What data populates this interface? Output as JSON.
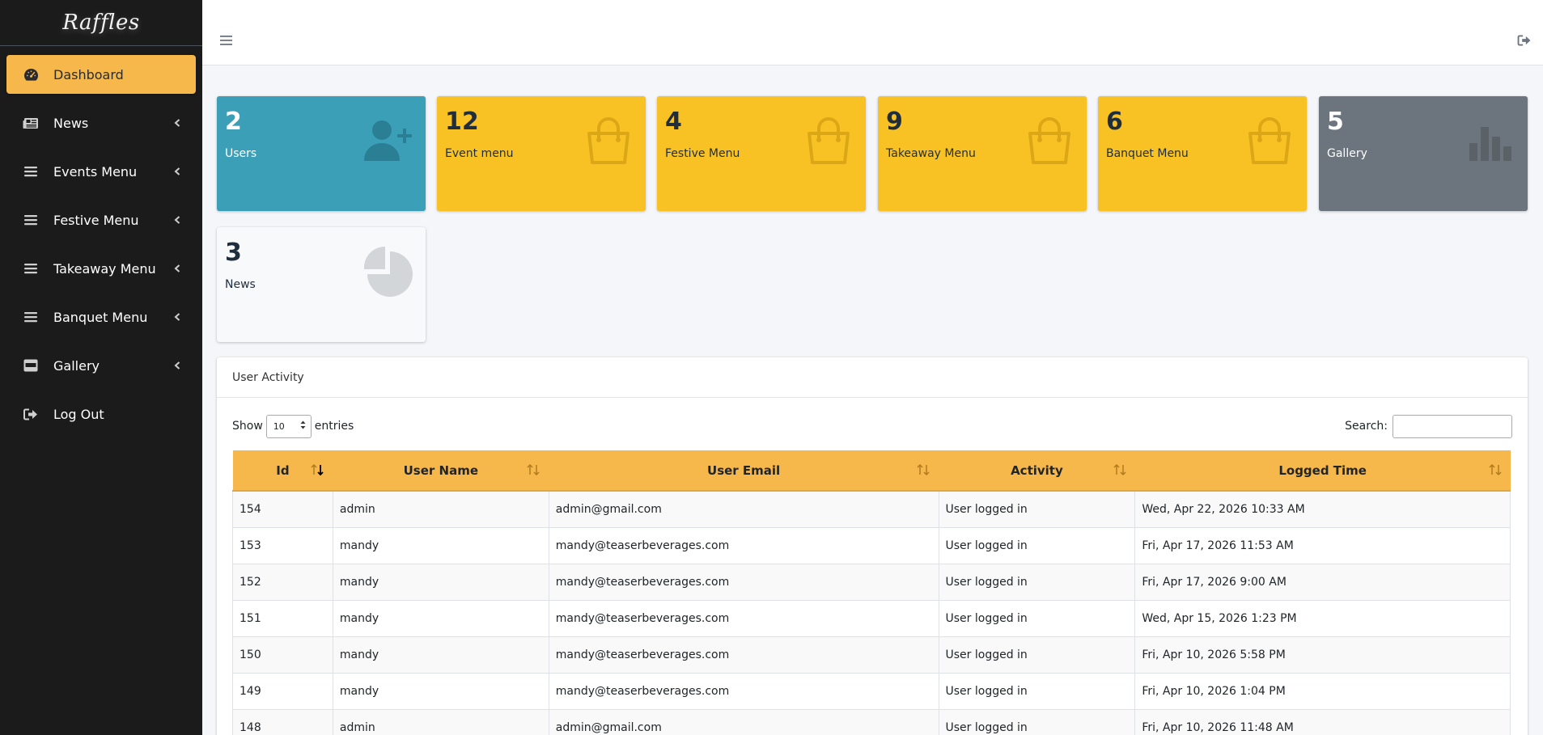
{
  "brand": {
    "logo_text": "Raffles"
  },
  "sidebar": {
    "items": [
      {
        "label": "Dashboard",
        "icon": "tachometer-icon",
        "active": true,
        "has_children": false
      },
      {
        "label": "News",
        "icon": "newspaper-icon",
        "has_children": true
      },
      {
        "label": "Events Menu",
        "icon": "bars-icon",
        "has_children": true
      },
      {
        "label": "Festive Menu",
        "icon": "bars-icon",
        "has_children": true
      },
      {
        "label": "Takeaway Menu",
        "icon": "bars-icon",
        "has_children": true
      },
      {
        "label": "Banquet Menu",
        "icon": "bars-icon",
        "has_children": true
      },
      {
        "label": "Gallery",
        "icon": "image-icon",
        "has_children": true
      },
      {
        "label": "Log Out",
        "icon": "sign-out-icon",
        "has_children": false
      }
    ]
  },
  "colors": {
    "accent": "#f6b84b",
    "teal": "#3c9fb8",
    "yellow": "#f8c224",
    "gray": "#6c757d",
    "sidebar": "#1b1b1b"
  },
  "stats": [
    {
      "count": "2",
      "label": "Users",
      "icon": "user-plus-icon"
    },
    {
      "count": "12",
      "label": "Event menu",
      "icon": "shopping-bag-icon"
    },
    {
      "count": "4",
      "label": "Festive Menu",
      "icon": "shopping-bag-icon"
    },
    {
      "count": "9",
      "label": "Takeaway Menu",
      "icon": "shopping-bag-icon"
    },
    {
      "count": "6",
      "label": "Banquet Menu",
      "icon": "shopping-bag-icon"
    },
    {
      "count": "5",
      "label": "Gallery",
      "icon": "bar-chart-icon"
    },
    {
      "count": "3",
      "label": "News",
      "icon": "pie-chart-icon"
    }
  ],
  "activity": {
    "title": "User Activity",
    "show_label": "Show",
    "entries_value": "10",
    "entries_label": "entries",
    "search_label": "Search:",
    "search_value": "",
    "columns": [
      "Id",
      "User Name",
      "User Email",
      "Activity",
      "Logged Time"
    ],
    "rows": [
      [
        "154",
        "admin",
        "admin@gmail.com",
        "User logged in",
        "Wed, Apr 22, 2026 10:33 AM"
      ],
      [
        "153",
        "mandy",
        "mandy@teaserbeverages.com",
        "User logged in",
        "Fri, Apr 17, 2026 11:53 AM"
      ],
      [
        "152",
        "mandy",
        "mandy@teaserbeverages.com",
        "User logged in",
        "Fri, Apr 17, 2026 9:00 AM"
      ],
      [
        "151",
        "mandy",
        "mandy@teaserbeverages.com",
        "User logged in",
        "Wed, Apr 15, 2026 1:23 PM"
      ],
      [
        "150",
        "mandy",
        "mandy@teaserbeverages.com",
        "User logged in",
        "Fri, Apr 10, 2026 5:58 PM"
      ],
      [
        "149",
        "mandy",
        "mandy@teaserbeverages.com",
        "User logged in",
        "Fri, Apr 10, 2026 1:04 PM"
      ],
      [
        "148",
        "admin",
        "admin@gmail.com",
        "User logged in",
        "Fri, Apr 10, 2026 11:48 AM"
      ]
    ]
  }
}
